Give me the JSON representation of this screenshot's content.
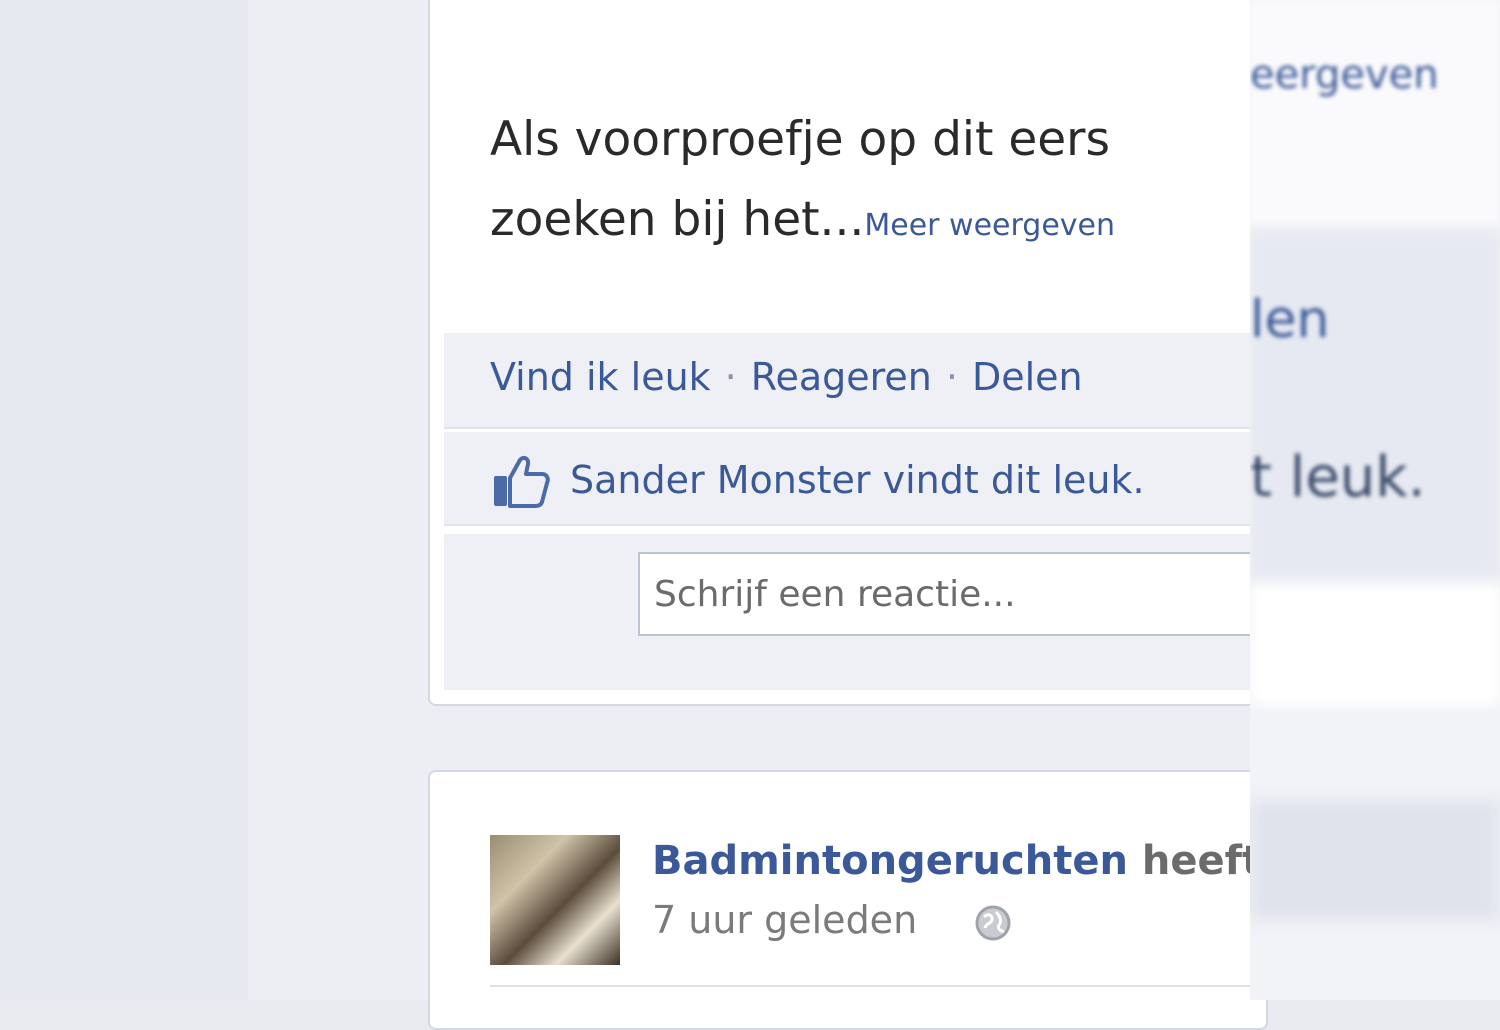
{
  "post1": {
    "text_line1": "Als voorproefje op dit eers",
    "text_line2": "zoeken bij het...",
    "more_link": "Meer weergeven",
    "actions": {
      "like": "Vind ik leuk",
      "comment": "Reageren",
      "share": "Delen",
      "separator": "·"
    },
    "likes_text": "Sander Monster vindt dit leuk.",
    "comment_placeholder": "Schrijf een reactie..."
  },
  "post2": {
    "poster_name": "Badmintongeruchten",
    "poster_rest": " heeft",
    "timestamp": "7 uur geleden"
  },
  "blurred_strip": {
    "line1": "eergeven",
    "line2": "len",
    "line3": "t leuk."
  },
  "icons": {
    "like": "thumbs-up-icon",
    "privacy": "globe-icon"
  },
  "colors": {
    "link": "#3b5998",
    "background": "#e9ebf1"
  }
}
